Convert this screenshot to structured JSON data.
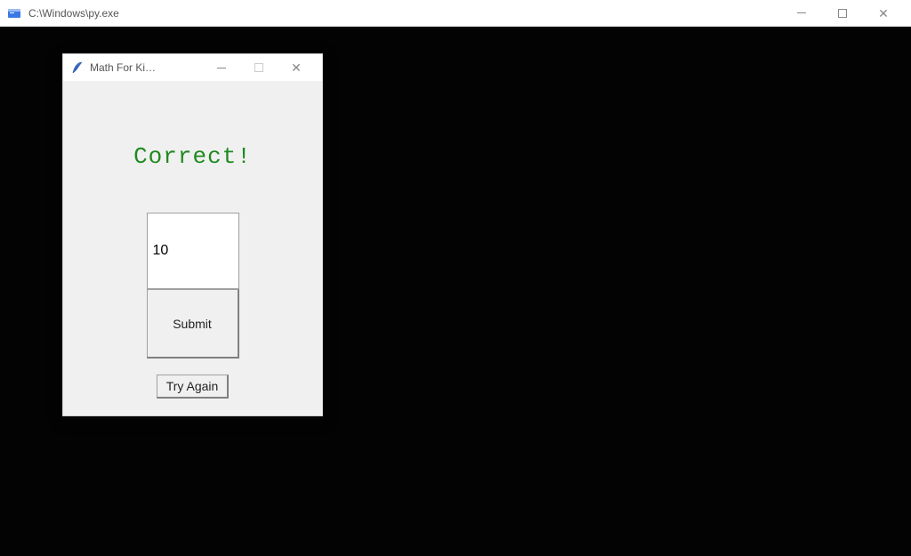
{
  "outer_window": {
    "title": "C:\\Windows\\py.exe"
  },
  "tk_window": {
    "title": "Math For Ki…",
    "result_label": "Correct!",
    "answer_value": "10",
    "submit_label": "Submit",
    "try_again_label": "Try Again"
  }
}
